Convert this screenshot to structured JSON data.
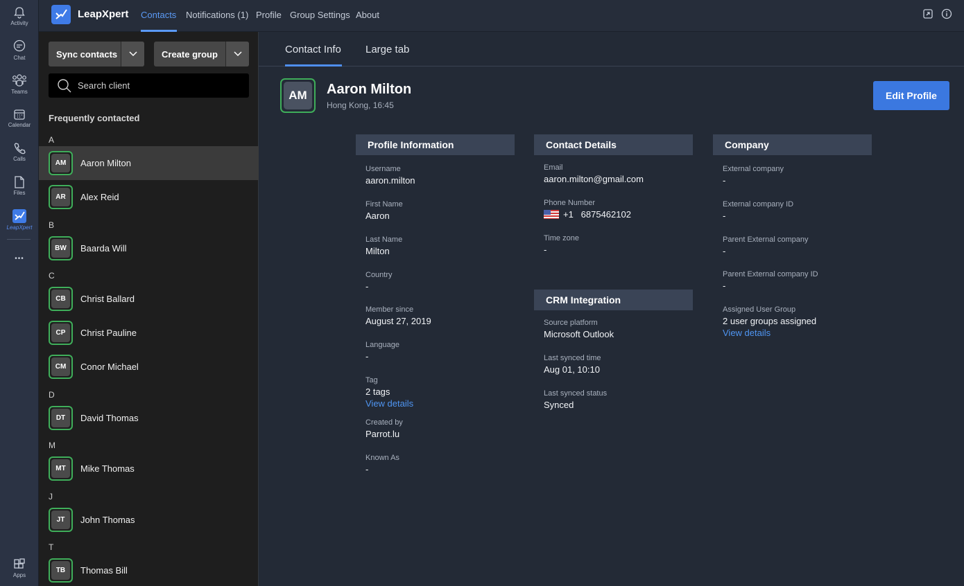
{
  "rail": {
    "items": [
      {
        "label": "Activity",
        "icon": "bell-icon"
      },
      {
        "label": "Chat",
        "icon": "chat-icon"
      },
      {
        "label": "Teams",
        "icon": "teams-icon"
      },
      {
        "label": "Calendar",
        "icon": "calendar-icon"
      },
      {
        "label": "Calls",
        "icon": "phone-icon"
      },
      {
        "label": "Files",
        "icon": "file-icon"
      },
      {
        "label": "LeapXpert",
        "icon": "leapxpert-icon"
      },
      {
        "label": "Apps",
        "icon": "apps-icon"
      }
    ],
    "more": "•••"
  },
  "topbar": {
    "brand": "LeapXpert",
    "nav": [
      "Contacts",
      "Notifications (1)",
      "Profile",
      "Group Settings",
      "About"
    ]
  },
  "sidebar": {
    "sync_label": "Sync contacts",
    "create_label": "Create group",
    "search_placeholder": "Search client",
    "freq_title": "Frequently contacted",
    "letters": [
      "A",
      "B",
      "C",
      "D",
      "M",
      "J",
      "T"
    ],
    "contacts": [
      {
        "initials": "AM",
        "name": "Aaron Milton"
      },
      {
        "initials": "AR",
        "name": "Alex Reid"
      },
      {
        "initials": "BW",
        "name": "Baarda Will"
      },
      {
        "initials": "CB",
        "name": "Christ Ballard"
      },
      {
        "initials": "CP",
        "name": "Christ Pauline"
      },
      {
        "initials": "CM",
        "name": "Conor Michael"
      },
      {
        "initials": "DT",
        "name": "David Thomas"
      },
      {
        "initials": "MT",
        "name": "Mike Thomas"
      },
      {
        "initials": "JT",
        "name": "John Thomas"
      },
      {
        "initials": "TB",
        "name": "Thomas Bill"
      }
    ]
  },
  "tabs": [
    "Contact Info",
    "Large tab"
  ],
  "profile": {
    "initials": "AM",
    "name": "Aaron Milton",
    "sub": "Hong Kong, 16:45",
    "edit_label": "Edit Profile"
  },
  "sections": {
    "profile_info": {
      "title": "Profile Information",
      "fields": [
        {
          "k": "Username",
          "v": "aaron.milton"
        },
        {
          "k": "First Name",
          "v": "Aaron"
        },
        {
          "k": "Last Name",
          "v": "Milton"
        },
        {
          "k": "Country",
          "v": "-"
        },
        {
          "k": "Member since",
          "v": "August 27, 2019"
        },
        {
          "k": "Language",
          "v": "-"
        },
        {
          "k": "Tag",
          "v": "2 tags",
          "link": "View details"
        },
        {
          "k": "Created by",
          "v": "Parrot.lu"
        },
        {
          "k": "Known As",
          "v": "-"
        }
      ]
    },
    "contact_details": {
      "title": "Contact Details",
      "email_k": "Email",
      "email_v": "aaron.milton@gmail.com",
      "phone_k": "Phone Number",
      "phone_v": "+1   6875462102",
      "tz_k": "Time zone",
      "tz_v": "-"
    },
    "crm": {
      "title": "CRM Integration",
      "fields": [
        {
          "k": "Source platform",
          "v": "Microsoft Outlook"
        },
        {
          "k": "Last synced time",
          "v": "Aug 01, 10:10"
        },
        {
          "k": "Last synced status",
          "v": "Synced"
        }
      ]
    },
    "company": {
      "title": "Company",
      "fields": [
        {
          "k": "External company",
          "v": "-"
        },
        {
          "k": "External company ID",
          "v": "-"
        },
        {
          "k": "Parent External company",
          "v": "-"
        },
        {
          "k": "Parent External company ID",
          "v": "-"
        },
        {
          "k": "Assigned User Group",
          "v": "2 user groups assigned",
          "link": "View details"
        }
      ]
    }
  },
  "colors": {
    "accent": "#3b78e0",
    "link": "#4f95f2",
    "avatar_border": "#3fae5a"
  }
}
